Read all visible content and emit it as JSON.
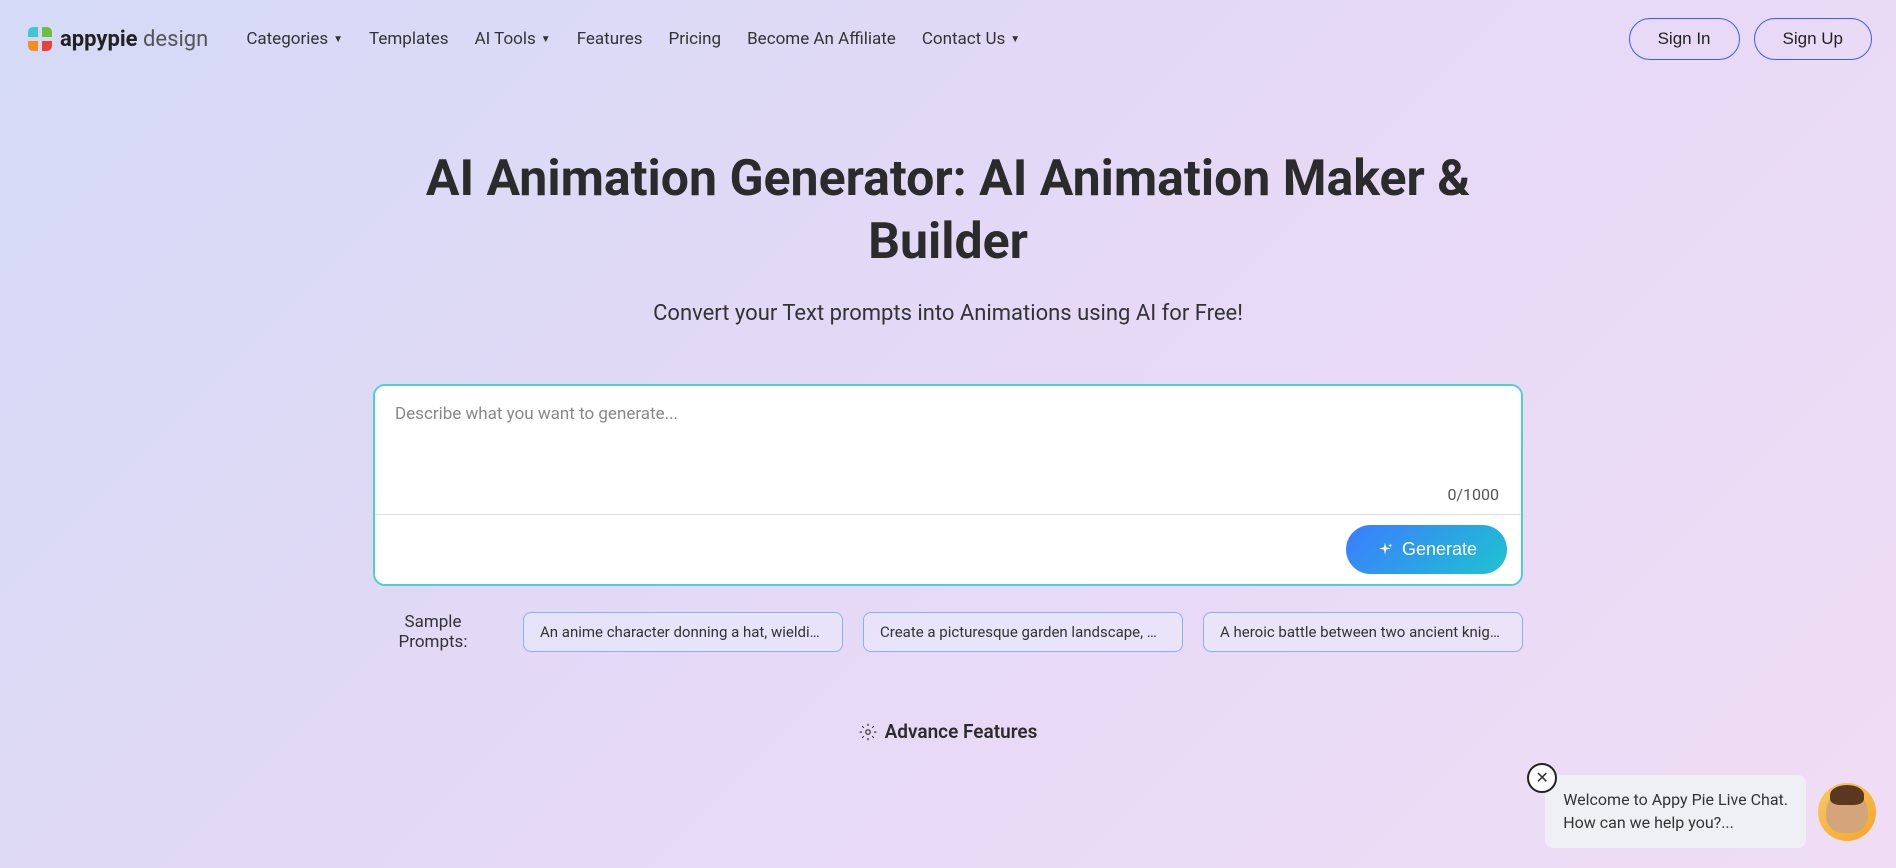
{
  "logo": {
    "bold": "appypie",
    "light": " design"
  },
  "nav": {
    "categories": "Categories",
    "templates": "Templates",
    "ai_tools": "AI Tools",
    "features": "Features",
    "pricing": "Pricing",
    "affiliate": "Become An Affiliate",
    "contact": "Contact Us"
  },
  "auth": {
    "signin": "Sign In",
    "signup": "Sign Up"
  },
  "hero": {
    "title": "AI Animation Generator: AI Animation Maker & Builder",
    "subtitle": "Convert your Text prompts into Animations using AI for Free!"
  },
  "prompt": {
    "placeholder": "Describe what you want to generate...",
    "char_count": "0/1000",
    "generate_label": "Generate"
  },
  "samples": {
    "label": "Sample Prompts:",
    "items": [
      "An anime character donning a hat, wielding tw...",
      "Create a picturesque garden landscape, with a...",
      "A heroic battle between two ancient knights on..."
    ]
  },
  "advance": {
    "label": "Advance Features"
  },
  "chat": {
    "line1": "Welcome to Appy Pie Live Chat.",
    "line2": "How can we help you?..."
  }
}
